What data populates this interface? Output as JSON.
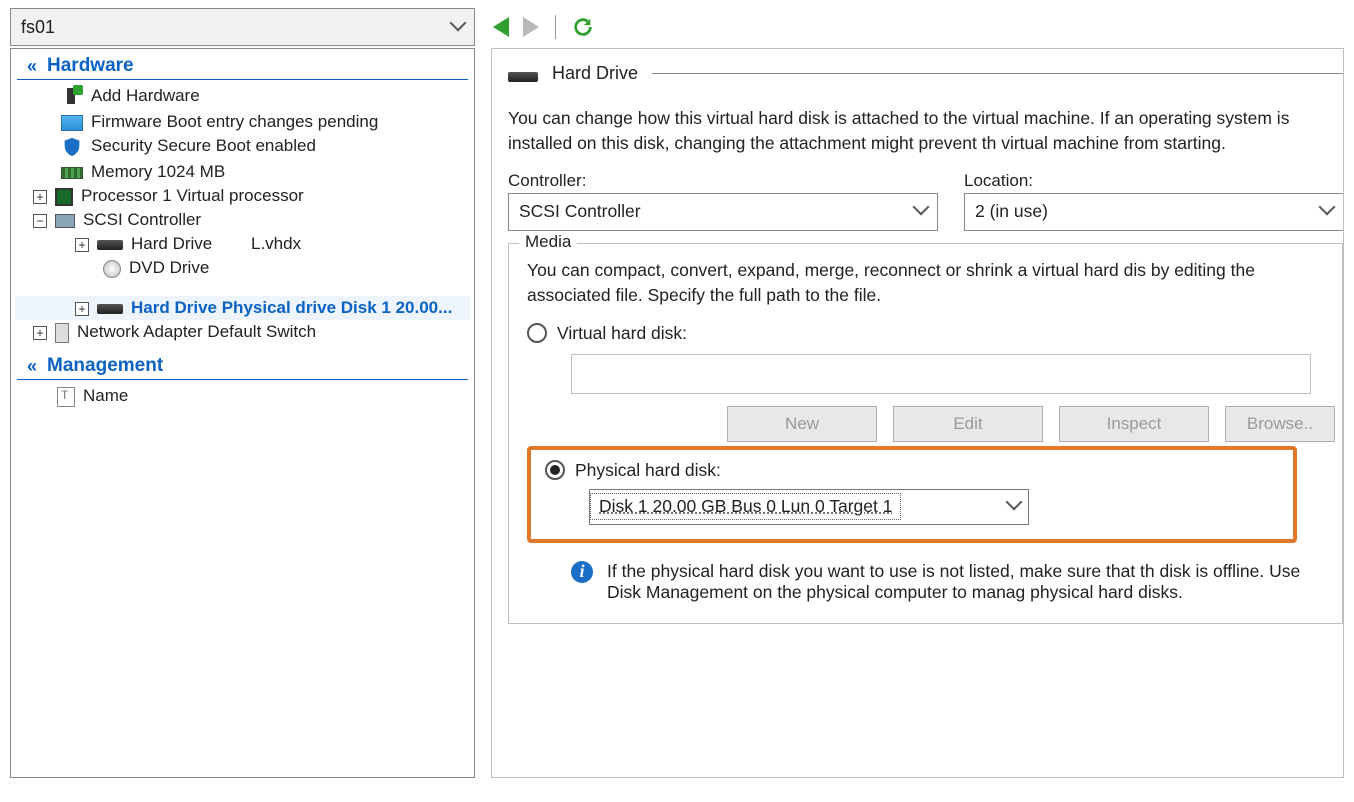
{
  "vm_selector": {
    "value": "fs01"
  },
  "toolbar": {
    "prev_enabled": true,
    "next_enabled": false
  },
  "sidebar": {
    "sections": {
      "hardware": {
        "title": "Hardware",
        "add_hardware": "Add Hardware",
        "firmware": {
          "label": "Firmware",
          "sub": "Boot entry changes pending"
        },
        "security": {
          "label": "Security",
          "sub": "Secure Boot enabled"
        },
        "memory": {
          "label": "Memory",
          "sub": "1024 MB"
        },
        "processor": {
          "label": "Processor",
          "sub": "1 Virtual processor"
        },
        "scsi": {
          "label": "SCSI Controller"
        },
        "hdd1": {
          "label": "Hard Drive",
          "sub": "L.vhdx"
        },
        "dvd": {
          "label": "DVD Drive"
        },
        "hdd2": {
          "label": "Hard Drive",
          "sub": "Physical drive Disk 1 20.00..."
        },
        "nic": {
          "label": "Network Adapter",
          "sub": "Default Switch"
        }
      },
      "management": {
        "title": "Management",
        "name": {
          "label": "Name"
        }
      }
    }
  },
  "panel": {
    "title": "Hard Drive",
    "desc": "You can change how this virtual hard disk is attached to the virtual machine. If an operating system is installed on this disk, changing the attachment might prevent th virtual machine from starting.",
    "controller_label": "Controller:",
    "controller_value": "SCSI Controller",
    "location_label": "Location:",
    "location_value": "2 (in use)",
    "media": {
      "legend": "Media",
      "desc": "You can compact, convert, expand, merge, reconnect or shrink a virtual hard dis by editing the associated file. Specify the full path to the file.",
      "vhd_label": "Virtual hard disk:",
      "vhd_path": "",
      "buttons": {
        "new": "New",
        "edit": "Edit",
        "inspect": "Inspect",
        "browse": "Browse.."
      },
      "phys_label": "Physical hard disk:",
      "phys_value": "Disk 1 20.00 GB Bus 0 Lun 0 Target 1",
      "info": "If the physical hard disk you want to use is not listed, make sure that th disk is offline. Use Disk Management on the physical computer to manag physical hard disks."
    }
  }
}
